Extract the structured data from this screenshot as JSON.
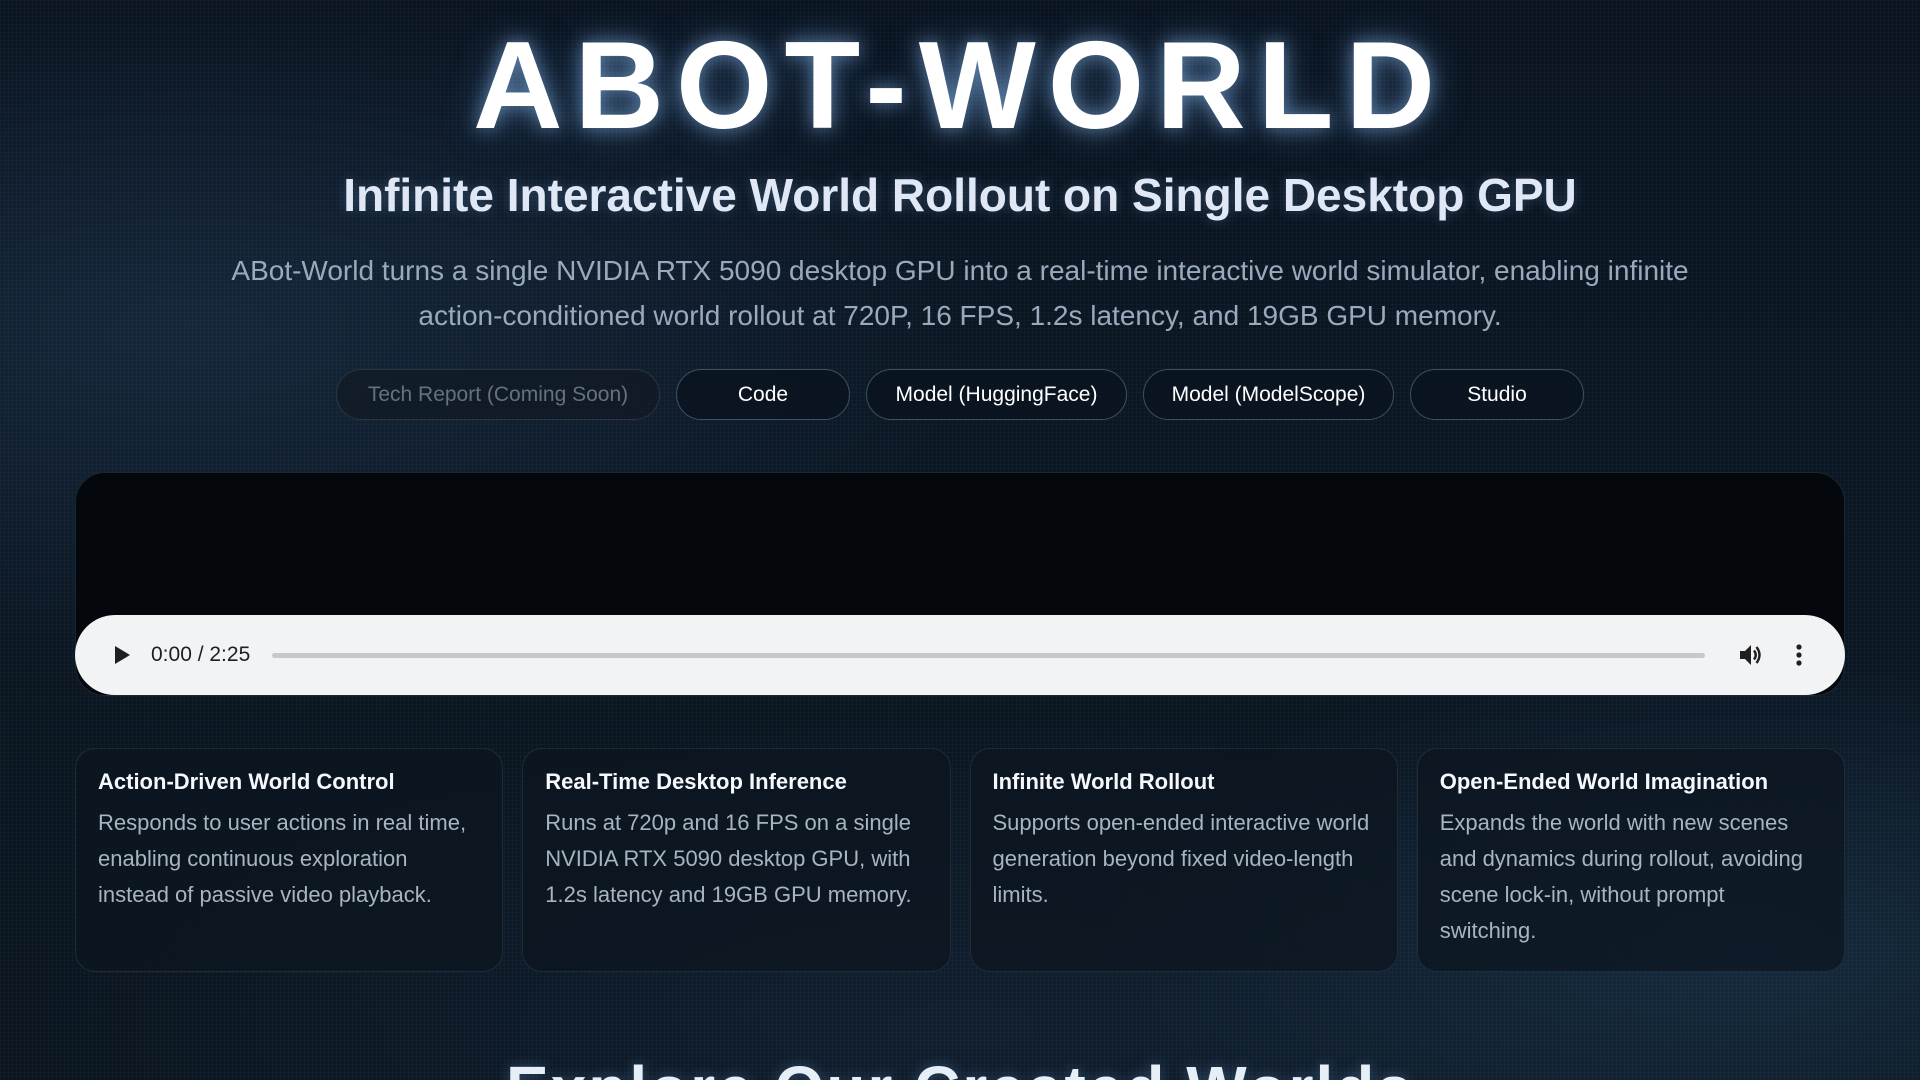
{
  "hero": {
    "title": "ABOT-WORLD",
    "subtitle": "Infinite Interactive World Rollout on Single Desktop GPU",
    "description": "ABot-World turns a single NVIDIA RTX 5090 desktop GPU into a real-time interactive world simulator, enabling infinite action-conditioned world rollout at 720P, 16 FPS, 1.2s latency, and 19GB GPU memory."
  },
  "links": [
    {
      "label": "Tech Report (Coming Soon)",
      "disabled": true
    },
    {
      "label": "Code",
      "disabled": false
    },
    {
      "label": "Model (HuggingFace)",
      "disabled": false
    },
    {
      "label": "Model (ModelScope)",
      "disabled": false
    },
    {
      "label": "Studio",
      "disabled": false
    }
  ],
  "player": {
    "time_display": "0:00 / 2:25",
    "progress_fraction": 0,
    "icons": {
      "play": "play-icon",
      "volume": "volume-icon",
      "more": "more-vert-icon"
    }
  },
  "features": [
    {
      "title": "Action-Driven World Control",
      "body": "Responds to user actions in real time, enabling continuous exploration instead of passive video playback."
    },
    {
      "title": "Real-Time Desktop Inference",
      "body": "Runs at 720p and 16 FPS on a single NVIDIA RTX 5090 desktop GPU, with 1.2s latency and 19GB GPU memory."
    },
    {
      "title": "Infinite World Rollout",
      "body": "Supports open-ended interactive world generation beyond fixed video-length limits."
    },
    {
      "title": "Open-Ended World Imagination",
      "body": "Expands the world with new scenes and dynamics during rollout, avoiding scene lock-in, without prompt switching."
    }
  ],
  "next_section": {
    "heading": "Explore Our Created Worlds"
  },
  "colors": {
    "background": "#0b1724",
    "accent_glow": "#96c8ff",
    "pill_border": "#3f5063",
    "player_bar": "#f1f3f4"
  }
}
